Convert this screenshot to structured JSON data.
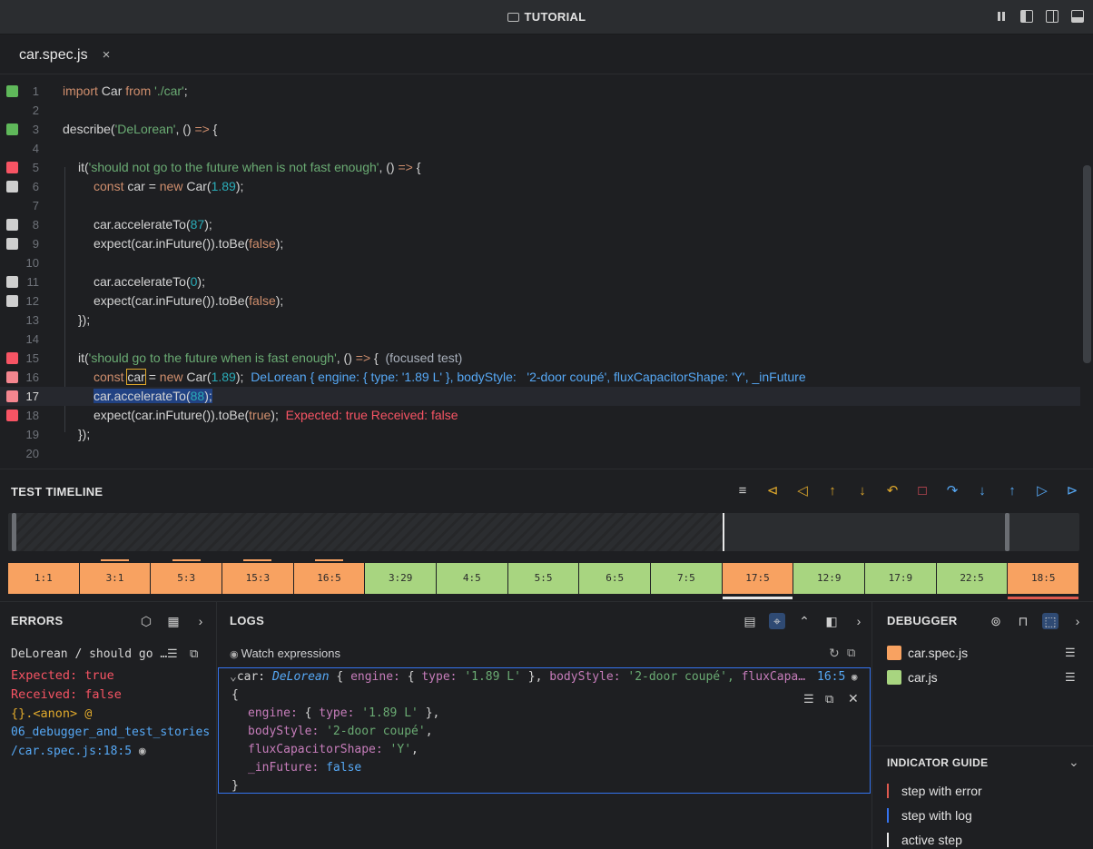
{
  "window": {
    "title": "TUTORIAL"
  },
  "tab": {
    "label": "car.spec.js",
    "close": "×"
  },
  "colors": {
    "error": "#f75464",
    "ok": "#5fb85a",
    "neutral": "#cfcfcf",
    "step_err": "#f8a261",
    "step_ok": "#a8d580"
  },
  "code": {
    "lines": [
      {
        "n": "1",
        "mark": "ok"
      },
      {
        "n": "2"
      },
      {
        "n": "3",
        "mark": "ok"
      },
      {
        "n": "4"
      },
      {
        "n": "5",
        "mark": "error"
      },
      {
        "n": "6",
        "mark": "neutral"
      },
      {
        "n": "7"
      },
      {
        "n": "8",
        "mark": "neutral"
      },
      {
        "n": "9",
        "mark": "neutral"
      },
      {
        "n": "10"
      },
      {
        "n": "11",
        "mark": "neutral"
      },
      {
        "n": "12",
        "mark": "neutral"
      },
      {
        "n": "13"
      },
      {
        "n": "14"
      },
      {
        "n": "15",
        "mark": "error"
      },
      {
        "n": "16",
        "mark": "error-light"
      },
      {
        "n": "17",
        "mark": "error-light"
      },
      {
        "n": "18",
        "mark": "error"
      },
      {
        "n": "19"
      },
      {
        "n": "20"
      }
    ],
    "t": {
      "l1a": "import",
      "l1b": " Car ",
      "l1c": "from",
      "l1d": " './car'",
      "l1e": ";",
      "l3a": "describe(",
      "l3b": "'DeLorean'",
      "l3c": ", () ",
      "l3d": "=>",
      "l3e": " {",
      "l5a": "it(",
      "l5b": "'should not go to the future when is not fast enough'",
      "l5c": ", () ",
      "l5d": "=>",
      "l5e": " {",
      "l6a": "const",
      "l6b": " car = ",
      "l6c": "new",
      "l6d": " Car(",
      "l6e": "1.89",
      "l6f": ");",
      "l8a": "car.accelerateTo(",
      "l8b": "87",
      "l8c": ");",
      "l9a": "expect(car.inFuture()).toBe(",
      "l9b": "false",
      "l9c": ");",
      "l11a": "car.accelerateTo(",
      "l11b": "0",
      "l11c": ");",
      "l12a": "expect(car.inFuture()).toBe(",
      "l12b": "false",
      "l12c": ");",
      "l13": "});",
      "l15a": "it(",
      "l15b": "'should go to the future when is fast enough'",
      "l15c": ", () ",
      "l15d": "=>",
      "l15e": " {",
      "l15f": "  (focused test)",
      "l16a": "const",
      "l16b": " ",
      "l16c": "car",
      "l16d": " = ",
      "l16e": "new",
      "l16f": " Car(",
      "l16g": "1.89",
      "l16h": ");",
      "l16i": "DeLorean { engine: { type: '1.89 L' }, bodyStyle:   '2-door coupé', fluxCapacitorShape: 'Y', _inFuture",
      "l17a": "car.accelerateTo(",
      "l17b": "88",
      "l17c": ");",
      "l18a": "expect(car.inFuture()).toBe(",
      "l18b": "true",
      "l18c": ");",
      "l18d": "Expected: true Received: false",
      "l19": "});"
    }
  },
  "timeline": {
    "title": "TEST TIMELINE",
    "controls": [
      "≡",
      "⊲",
      "◁",
      "↑",
      "↓",
      "↶",
      "□",
      "↷",
      "↓",
      "↑",
      "▷",
      "⊳"
    ],
    "steps": [
      {
        "label": "1:1",
        "status": "err"
      },
      {
        "label": "3:1",
        "status": "err",
        "log": true
      },
      {
        "label": "5:3",
        "status": "err",
        "log": true
      },
      {
        "label": "15:3",
        "status": "err",
        "log": true
      },
      {
        "label": "16:5",
        "status": "err",
        "log": true
      },
      {
        "label": "3:29",
        "status": "ok"
      },
      {
        "label": "4:5",
        "status": "ok"
      },
      {
        "label": "5:5",
        "status": "ok"
      },
      {
        "label": "6:5",
        "status": "ok"
      },
      {
        "label": "7:5",
        "status": "ok"
      },
      {
        "label": "17:5",
        "status": "err",
        "active": true
      },
      {
        "label": "12:9",
        "status": "ok"
      },
      {
        "label": "17:9",
        "status": "ok"
      },
      {
        "label": "22:5",
        "status": "ok"
      },
      {
        "label": "18:5",
        "status": "err",
        "errline": true
      }
    ]
  },
  "errors": {
    "title": "ERRORS",
    "item": "DeLorean / should go …",
    "expected": "Expected: true",
    "received": "Received: false",
    "frame": "{}.<anon> @",
    "path1": "06_debugger_and_test_stories",
    "path2": "/car.spec.js:18:5"
  },
  "logs": {
    "title": "LOGS",
    "watch_label": "Watch expressions",
    "head": {
      "a": "car:",
      "b": "DeLorean",
      "c": "{",
      "d": "engine:",
      "e": "{",
      "f": "type:",
      "g": "'1.89 L'",
      "h": "},",
      "i": "bodyStyle:",
      "j": "'2-door coupé',",
      "k": "fluxCapa…",
      "loc": "16:5"
    },
    "body": {
      "open": "{",
      "p1": "engine:",
      "p1v1": " { ",
      "p1k": "type:",
      "p1v": " '1.89 L'",
      "p1e": " },",
      "p2": "bodyStyle:",
      "p2v": " '2-door coupé'",
      "p2e": ",",
      "p3": "fluxCapacitorShape:",
      "p3v": " 'Y'",
      "p3e": ",",
      "p4": "_inFuture:",
      "p4v": " false",
      "close": "}"
    }
  },
  "debugger": {
    "title": "DEBUGGER",
    "files": [
      {
        "name": "car.spec.js",
        "color": "#f8a261"
      },
      {
        "name": "car.js",
        "color": "#a8d580"
      }
    ]
  },
  "guide": {
    "title": "INDICATOR GUIDE",
    "items": [
      {
        "label": "step with error",
        "color": "#e05a4f"
      },
      {
        "label": "step with log",
        "color": "#3574f0"
      },
      {
        "label": "active step",
        "color": "#e8e8e8"
      }
    ]
  }
}
